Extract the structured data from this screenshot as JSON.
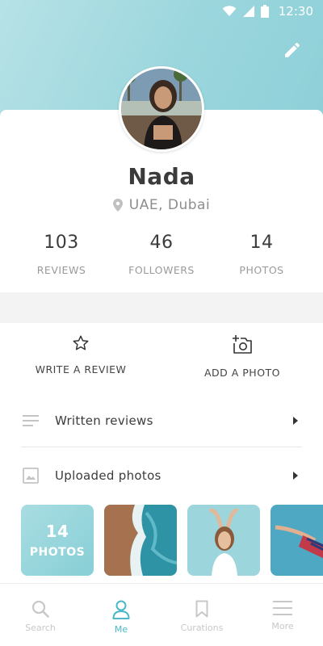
{
  "status_bar": {
    "time": "12:30"
  },
  "profile": {
    "name": "Nada",
    "location": "UAE, Dubai",
    "stats": [
      {
        "value": "103",
        "label": "REVIEWS"
      },
      {
        "value": "46",
        "label": "FOLLOWERS"
      },
      {
        "value": "14",
        "label": "PHOTOS"
      }
    ]
  },
  "actions": {
    "write_review": "WRITE A REVIEW",
    "add_photo": "ADD A PHOTO"
  },
  "menu": {
    "written_reviews": "Written reviews",
    "uploaded_photos": "Uploaded photos"
  },
  "photos_strip": {
    "count": "14",
    "label": "PHOTOS"
  },
  "tabs": [
    {
      "label": "Search",
      "icon": "search-icon",
      "active": false
    },
    {
      "label": "Me",
      "icon": "person-icon",
      "active": true
    },
    {
      "label": "Curations",
      "icon": "bookmark-icon",
      "active": false
    },
    {
      "label": "More",
      "icon": "menu-icon",
      "active": false
    }
  ],
  "colors": {
    "accent": "#4cb8c8",
    "header_start": "#b6e2e6",
    "header_end": "#8ed0d8"
  }
}
